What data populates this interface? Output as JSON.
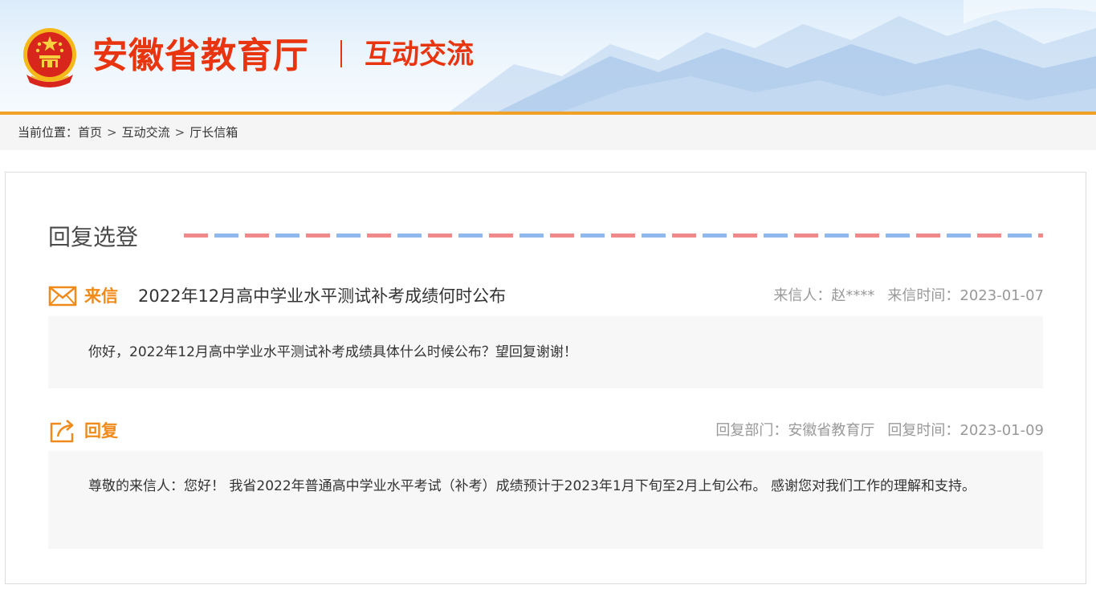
{
  "header": {
    "site_title": "安徽省教育厅",
    "section_title": "互动交流"
  },
  "breadcrumb": {
    "prefix": "当前位置：",
    "items": [
      "首页",
      "互动交流",
      "厅长信箱"
    ],
    "separator": ">"
  },
  "page_title": "回复选登",
  "letter": {
    "label": "来信",
    "subject": "2022年12月高中学业水平测试补考成绩何时公布",
    "sender_label": "来信人：",
    "sender": "赵****",
    "time_label": "来信时间：",
    "time": "2023-01-07",
    "body": "你好，2022年12月高中学业水平测试补考成绩具体什么时候公布？望回复谢谢！"
  },
  "reply": {
    "label": "回复",
    "dept_label": "回复部门：",
    "dept": "安徽省教育厅",
    "time_label": "回复时间：",
    "time": "2023-01-09",
    "body": "尊敬的来信人：您好！ 我省2022年普通高中学业水平考试（补考）成绩预计于2023年1月下旬至2月上旬公布。 感谢您对我们工作的理解和支持。"
  },
  "colors": {
    "brand_red": "#e8340f",
    "accent_orange": "#f08a1a",
    "header_bar": "#f0a125",
    "dash_red": "#f08a8a",
    "dash_blue": "#8fb8ee"
  },
  "icons": [
    "national-emblem-icon",
    "mail-icon",
    "reply-share-icon"
  ]
}
